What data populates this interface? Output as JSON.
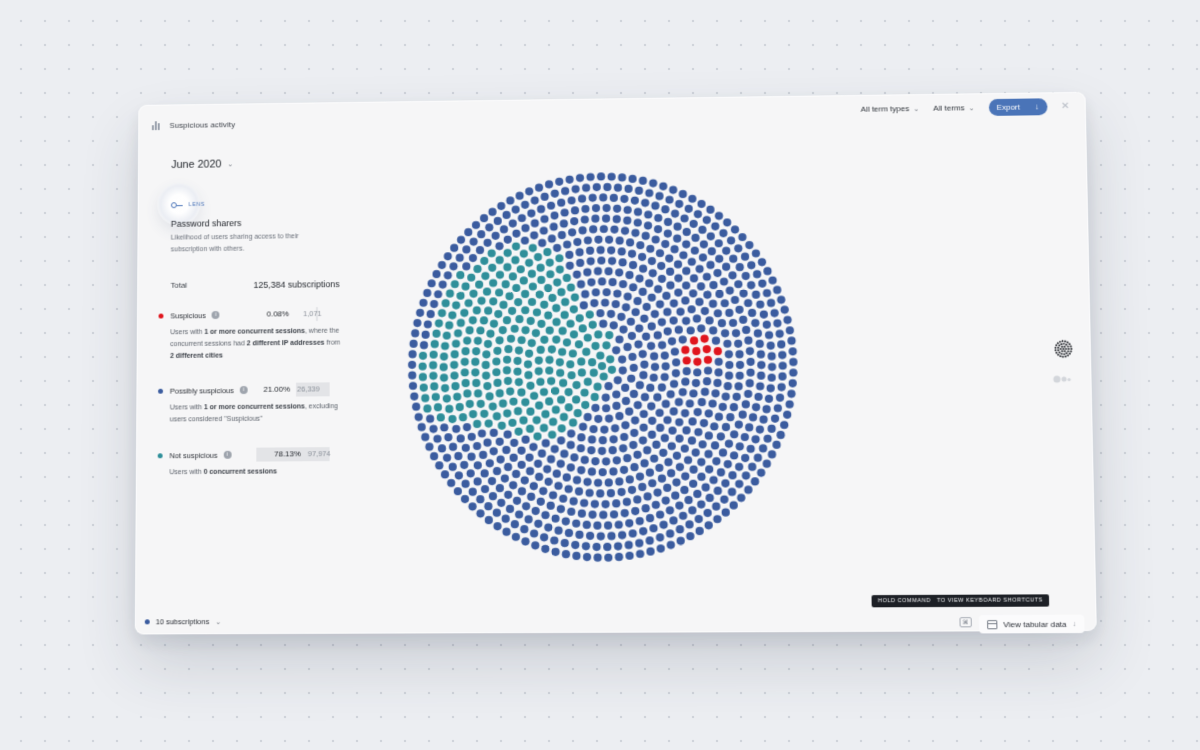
{
  "window": {
    "title": "Suspicious activity",
    "controls": {
      "term_types": "All term types",
      "terms": "All terms",
      "export": "Export"
    }
  },
  "period": "June 2020",
  "lens": {
    "label": "LENS",
    "title": "Password sharers",
    "description": "Likelihood of users sharing access to their subscription with others."
  },
  "total": {
    "label": "Total",
    "value": "125,384 subscriptions"
  },
  "categories": [
    {
      "name": "Suspicious",
      "color": "#e0151d",
      "percent": "0.08%",
      "count": "1,071",
      "fraction": 0.0008,
      "desc_parts": [
        "Users with ",
        "1 or more concurrent sessions",
        ", where the concurrent sessions had ",
        "2 different IP addresses",
        " from ",
        "2 different cities"
      ]
    },
    {
      "name": "Possibly suspicious",
      "color": "#3b5c9f",
      "percent": "21.00%",
      "count": "26,339",
      "fraction": 0.21,
      "desc_parts": [
        "Users with ",
        "1 or more concurrent sessions",
        ", excluding users considered \"Suspicious\""
      ]
    },
    {
      "name": "Not suspicious",
      "color": "#2f8f9a",
      "percent": "78.13%",
      "count": "97,974",
      "fraction": 0.7813,
      "desc_parts": [
        "Users with ",
        "0 concurrent sessions"
      ]
    }
  ],
  "legend": {
    "unit": "10 subscriptions"
  },
  "keyboard_hint": {
    "part1": "HOLD COMMAND",
    "part2": "TO VIEW KEYBOARD SHORTCUTS"
  },
  "view_tabular": "View tabular data",
  "icons": {
    "title": "bar-chart-icon",
    "lens": "key-icon",
    "info": "info-icon",
    "export": "download-arrow-icon",
    "close": "close-icon",
    "dots_view": "dot-grid-icon",
    "toggle": "toggle-icon",
    "keyboard": "command-key-icon",
    "table": "table-icon"
  },
  "colors": {
    "accent": "#4a74b8",
    "dot_blue": "#3b5c9f",
    "dot_teal": "#2f8f9a",
    "dot_red": "#e0151d"
  },
  "viz": {
    "type": "dot-packing",
    "red_dots": 9,
    "teal_region": "upper-left"
  }
}
